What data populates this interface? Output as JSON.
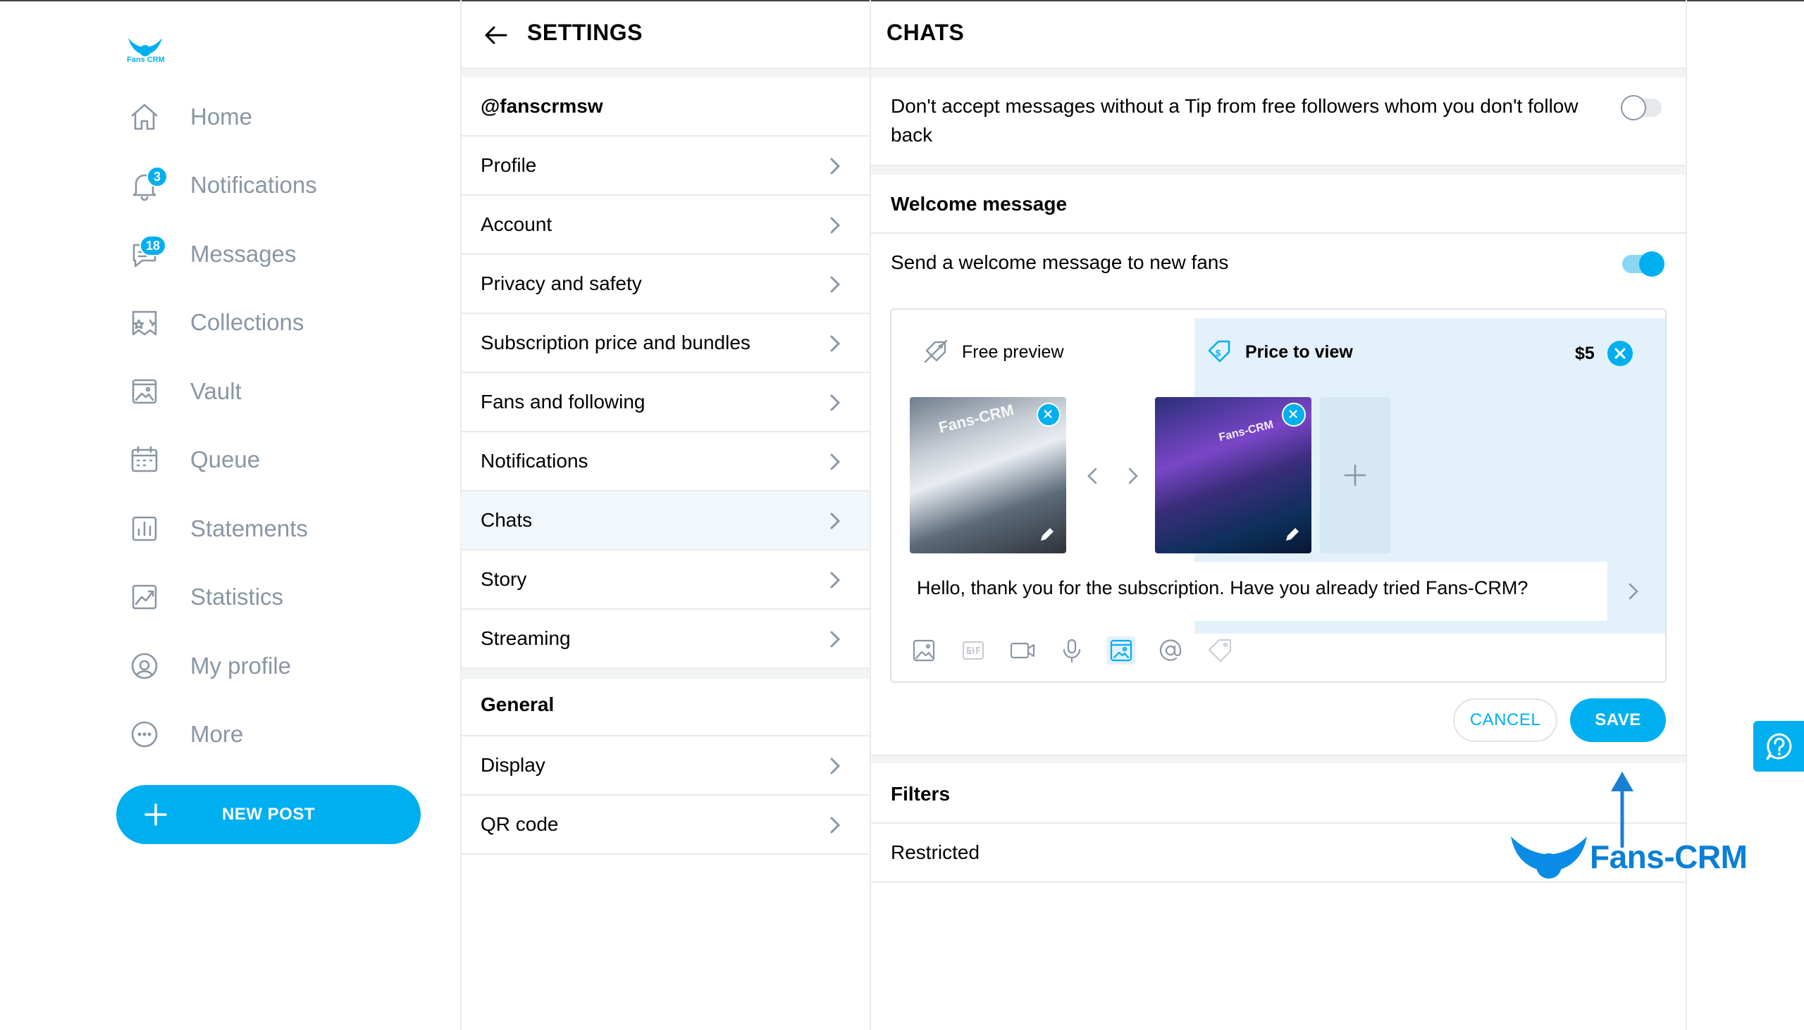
{
  "app": {
    "logo_text": "Fans CRM",
    "accent_color": "#00aff0",
    "muted_color": "#8a96a3"
  },
  "sidebar": {
    "items": [
      {
        "label": "Home",
        "icon": "home-icon"
      },
      {
        "label": "Notifications",
        "icon": "bell-icon",
        "badge": "3"
      },
      {
        "label": "Messages",
        "icon": "message-icon",
        "badge": "18"
      },
      {
        "label": "Collections",
        "icon": "collections-icon"
      },
      {
        "label": "Vault",
        "icon": "vault-icon"
      },
      {
        "label": "Queue",
        "icon": "calendar-icon"
      },
      {
        "label": "Statements",
        "icon": "statements-icon"
      },
      {
        "label": "Statistics",
        "icon": "statistics-icon"
      },
      {
        "label": "My profile",
        "icon": "profile-icon"
      },
      {
        "label": "More",
        "icon": "more-icon"
      }
    ],
    "new_post_label": "NEW POST"
  },
  "settings": {
    "title": "SETTINGS",
    "username": "@fanscrmsw",
    "items": [
      {
        "label": "Profile"
      },
      {
        "label": "Account"
      },
      {
        "label": "Privacy and safety"
      },
      {
        "label": "Subscription price and bundles"
      },
      {
        "label": "Fans and following"
      },
      {
        "label": "Notifications"
      },
      {
        "label": "Chats",
        "active": true
      },
      {
        "label": "Story"
      },
      {
        "label": "Streaming"
      }
    ],
    "general_header": "General",
    "general_items": [
      {
        "label": "Display"
      },
      {
        "label": "QR code"
      }
    ]
  },
  "chats": {
    "title": "CHATS",
    "tip_setting_line1": "Don't accept messages without a Tip from free followers whom you don't follow",
    "tip_setting_line2": "back",
    "tip_setting_enabled": false,
    "welcome_header": "Welcome message",
    "welcome_toggle_label": "Send a welcome message to new fans",
    "welcome_enabled": true,
    "composer": {
      "free_preview_label": "Free preview",
      "price_to_view_label": "Price to view",
      "price": "$5",
      "thumb1_watermark": "Fans-CRM",
      "thumb2_watermark": "Fans-CRM",
      "message": "Hello, thank you for the subscription. Have you already tried Fans-CRM?",
      "tools": [
        "image-icon",
        "gif-icon",
        "video-icon",
        "microphone-icon",
        "vault-media-icon",
        "mention-icon",
        "price-tag-icon"
      ]
    },
    "cancel_label": "CANCEL",
    "save_label": "SAVE",
    "filters_header": "Filters",
    "restricted_label": "Restricted"
  },
  "overlay": {
    "brand_text": "Fans-CRM"
  }
}
